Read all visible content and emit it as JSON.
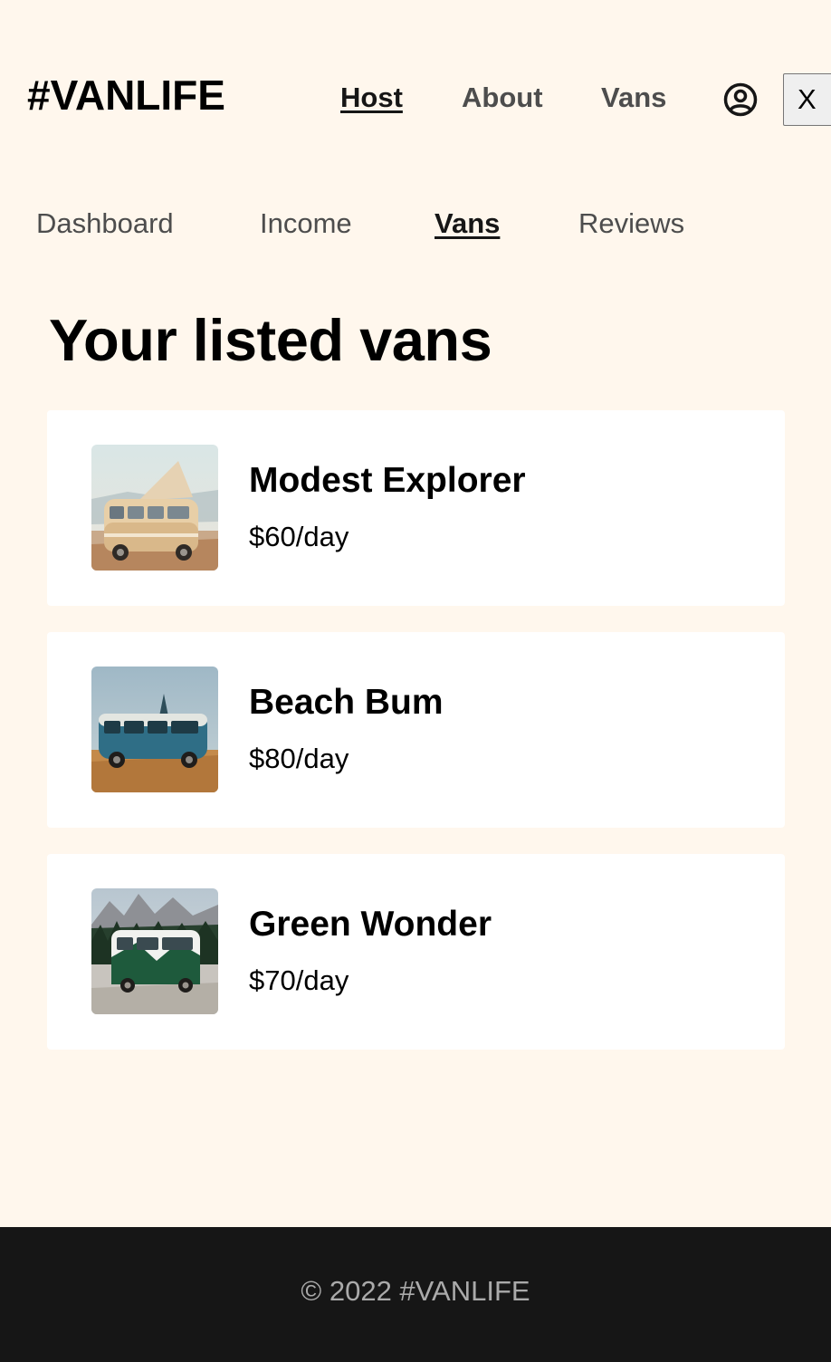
{
  "header": {
    "logo": "#VANLIFE",
    "nav": {
      "host": "Host",
      "about": "About",
      "vans": "Vans"
    },
    "close_label": "X",
    "avatar_icon": "user-circle-icon"
  },
  "subnav": {
    "items": [
      "Dashboard",
      "Income",
      "Vans",
      "Reviews"
    ],
    "active": "Vans"
  },
  "page": {
    "title": "Your listed vans"
  },
  "vans": [
    {
      "name": "Modest Explorer",
      "price": "$60/day"
    },
    {
      "name": "Beach Bum",
      "price": "$80/day"
    },
    {
      "name": "Green Wonder",
      "price": "$70/day"
    }
  ],
  "footer": {
    "text": "© 2022 #VANLIFE"
  },
  "colors": {
    "background": "#FFF7ED",
    "card": "#FFFFFF",
    "footer_bg": "#161616",
    "footer_text": "#AAAAAA",
    "nav_inactive": "#4D4D4D",
    "text_primary": "#161616"
  }
}
